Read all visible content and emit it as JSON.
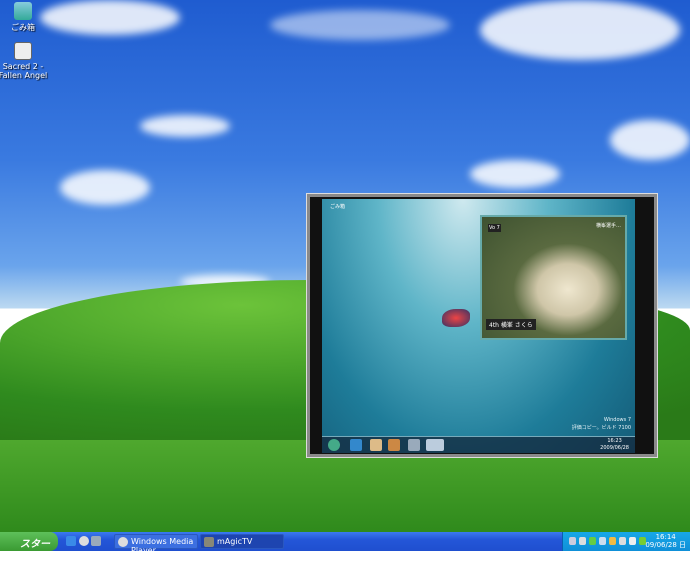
{
  "desktop": {
    "icons": [
      {
        "label": "ごみ箱"
      },
      {
        "label": "Sacred 2 - Fallen Angel"
      }
    ]
  },
  "window": {
    "win7": {
      "watermark_line1": "Windows 7",
      "watermark_line2": "評価コピー。ビルド 7100",
      "clock_time": "16:23",
      "clock_date": "2009/06/28",
      "desktop_icon": "ごみ箱"
    },
    "tv": {
      "caption": "4th 横峯 さくら",
      "top_text": "横峯選手…",
      "channel": "Vo 7"
    }
  },
  "taskbar": {
    "start_label": "スタート",
    "tasks": [
      {
        "label": "Windows Media Player",
        "icon": "wmp-icon"
      },
      {
        "label": "mAgicTV",
        "icon": "tv-icon",
        "active": true
      }
    ],
    "clock_time": "16:14",
    "clock_date": "09/06/28 日"
  },
  "colors": {
    "taskbar": "#2456d8",
    "start": "#3a9a32",
    "tray": "#0f8fd8"
  }
}
